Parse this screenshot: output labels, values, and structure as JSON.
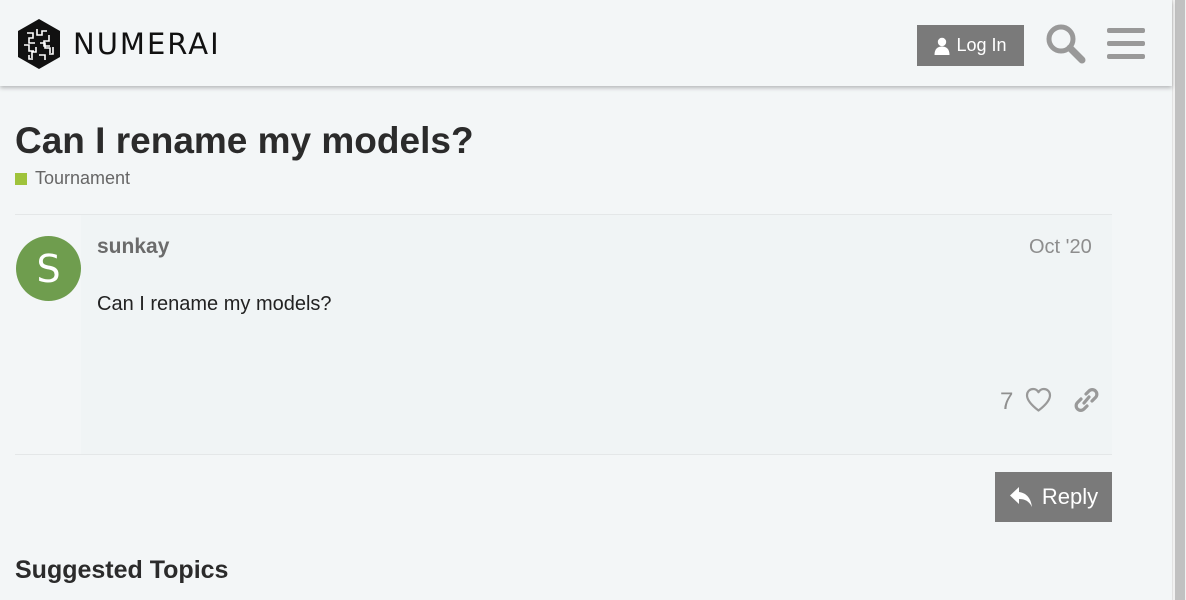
{
  "header": {
    "brand": "NUMERAI",
    "login_label": "Log In",
    "icons": {
      "login": "user-icon",
      "search": "search-icon",
      "menu": "hamburger-menu-icon"
    }
  },
  "topic": {
    "title": "Can I rename my models?",
    "category": {
      "label": "Tournament",
      "color": "#9fc33b"
    }
  },
  "post": {
    "avatar_letter": "S",
    "avatar_color": "#6f9d4e",
    "username": "sunkay",
    "date": "Oct '20",
    "body": "Can I rename my models?",
    "like_count": "7",
    "icons": {
      "like": "heart-icon",
      "share": "link-icon"
    }
  },
  "actions": {
    "reply_label": "Reply",
    "reply_icon": "reply-icon"
  },
  "suggested": {
    "heading": "Suggested Topics"
  },
  "colors": {
    "button_bg": "#7a7a7a",
    "page_bg": "#f3f6f7"
  }
}
